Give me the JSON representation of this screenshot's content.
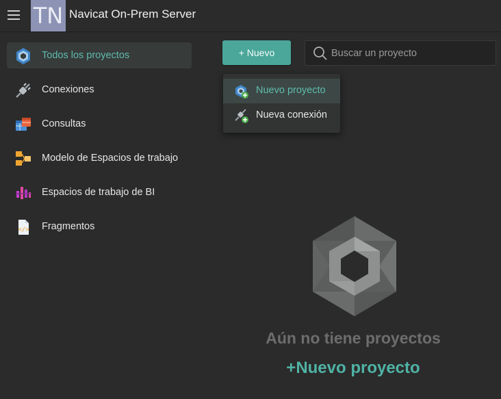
{
  "header": {
    "avatar_initials": "TN",
    "app_title": "Navicat On-Prem Server"
  },
  "sidebar": {
    "items": [
      {
        "label": "Todos los proyectos",
        "icon": "all-projects-icon",
        "active": true
      },
      {
        "label": "Conexiones",
        "icon": "connections-plug-icon"
      },
      {
        "label": "Consultas",
        "icon": "queries-table-icon"
      },
      {
        "label": "Modelo de Espacios de trabajo",
        "icon": "model-workspace-icon"
      },
      {
        "label": "Espacios de trabajo de BI",
        "icon": "bi-workspace-icon"
      },
      {
        "label": "Fragmentos",
        "icon": "snippets-icon"
      }
    ]
  },
  "toolbar": {
    "new_label": "+ Nuevo",
    "search_placeholder": "Buscar un proyecto"
  },
  "new_menu": {
    "items": [
      {
        "label": "Nuevo proyecto",
        "icon": "new-project-icon",
        "highlighted": true
      },
      {
        "label": "Nueva conexión",
        "icon": "new-connection-icon"
      }
    ]
  },
  "empty_state": {
    "message": "Aún no tiene proyectos",
    "action": "+Nuevo proyecto"
  },
  "colors": {
    "accent": "#4aa79a",
    "accent_text": "#5fbcae",
    "background": "#2b2b2b"
  }
}
